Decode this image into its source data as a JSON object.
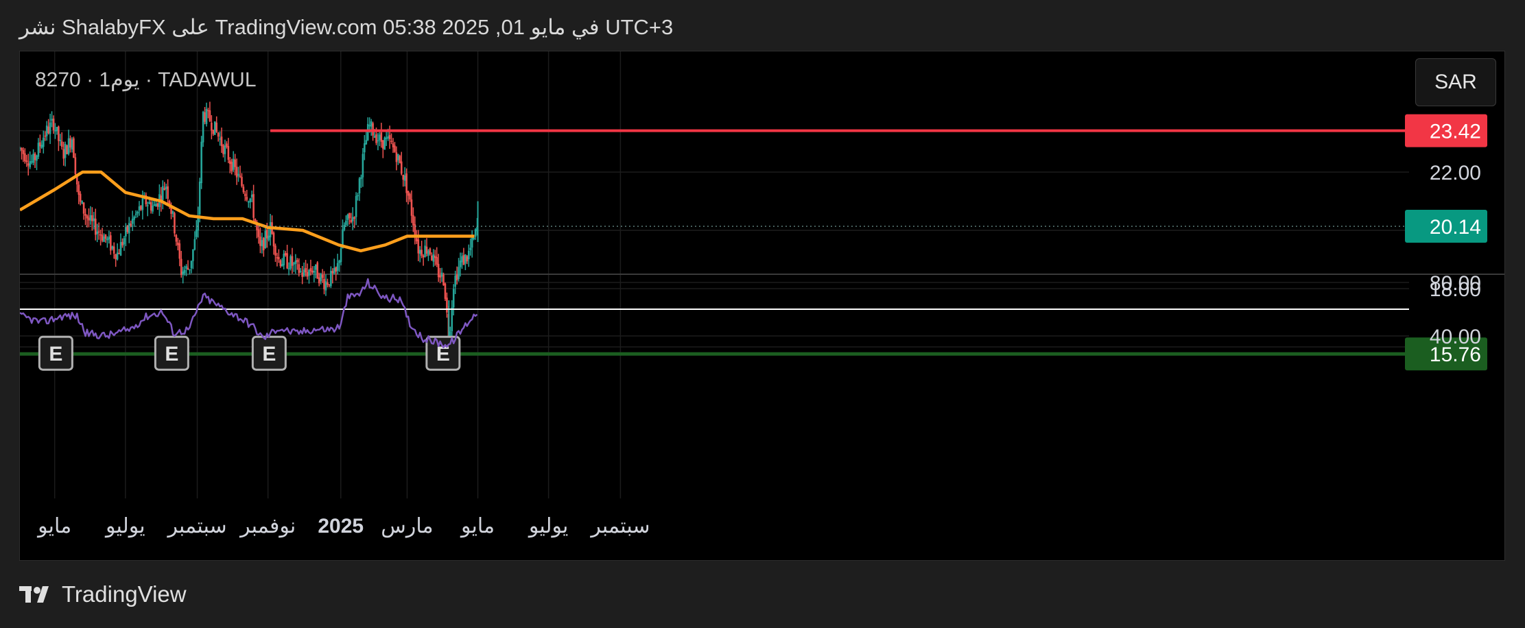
{
  "header": {
    "published_text": "نشر ShalabyFX على TradingView.com 05:38 2025 ,01 في مايو UTC+3"
  },
  "symbol": {
    "label": "8270 · يوم1 · TADAWUL"
  },
  "currency_button": {
    "label": "SAR"
  },
  "footer": {
    "brand": "TradingView"
  },
  "colors": {
    "background": "#000000",
    "page": "#1e1e1e",
    "up": "#26a69a",
    "down": "#ef5350",
    "ma": "#ff9f1c",
    "rsi": "#7e57c2",
    "resistance": "#f23645",
    "support": "#1b5e20",
    "last_price": "#089981",
    "grid": "#1c1c1c"
  },
  "chart_data": {
    "type": "candlestick",
    "price_axis": {
      "ticks": [
        "22.00",
        "18.00"
      ],
      "tick_values": [
        22.0,
        18.0
      ]
    },
    "price_labels": [
      {
        "name": "resistance",
        "value": 23.42,
        "text": "23.42",
        "color": "#f23645"
      },
      {
        "name": "last-price",
        "value": 20.14,
        "text": "20.14",
        "color": "#089981"
      },
      {
        "name": "support",
        "value": 15.76,
        "text": "15.76",
        "color": "#1b5e20"
      }
    ],
    "horizontal_lines": [
      {
        "name": "resistance-line",
        "value": 23.42,
        "color": "#f23645",
        "start_date": "2024-11-03"
      },
      {
        "name": "support-line",
        "value": 15.76,
        "color": "#1b5e20",
        "start_date": "2024-04-01"
      }
    ],
    "earnings_markers": [
      {
        "date": "2024-05-02",
        "label": "E"
      },
      {
        "date": "2024-08-10",
        "label": "E"
      },
      {
        "date": "2024-11-02",
        "label": "E"
      },
      {
        "date": "2025-04-01",
        "label": "E"
      }
    ],
    "time_axis": [
      {
        "date": "2024-05-01",
        "label": "مايو",
        "bold": false
      },
      {
        "date": "2024-07-01",
        "label": "يوليو",
        "bold": false
      },
      {
        "date": "2024-09-01",
        "label": "سبتمبر",
        "bold": false
      },
      {
        "date": "2024-11-01",
        "label": "نوفمبر",
        "bold": false
      },
      {
        "date": "2025-01-01",
        "label": "2025",
        "bold": true
      },
      {
        "date": "2025-03-01",
        "label": "مارس",
        "bold": false
      },
      {
        "date": "2025-05-01",
        "label": "مايو",
        "bold": false
      },
      {
        "date": "2025-07-01",
        "label": "يوليو",
        "bold": false
      },
      {
        "date": "2025-09-01",
        "label": "سبتمبر",
        "bold": false
      }
    ],
    "price_path": [
      [
        "2024-04-01",
        22.8
      ],
      [
        "2024-04-12",
        22.3
      ],
      [
        "2024-04-22",
        23.3
      ],
      [
        "2024-04-30",
        23.7
      ],
      [
        "2024-05-08",
        22.6
      ],
      [
        "2024-05-16",
        23.2
      ],
      [
        "2024-05-22",
        21.0
      ],
      [
        "2024-05-31",
        20.3
      ],
      [
        "2024-06-12",
        19.8
      ],
      [
        "2024-06-24",
        19.2
      ],
      [
        "2024-07-05",
        20.2
      ],
      [
        "2024-07-18",
        21.0
      ],
      [
        "2024-07-26",
        20.8
      ],
      [
        "2024-08-05",
        21.6
      ],
      [
        "2024-08-12",
        20.2
      ],
      [
        "2024-08-18",
        18.6
      ],
      [
        "2024-08-25",
        18.7
      ],
      [
        "2024-09-01",
        20.0
      ],
      [
        "2024-09-06",
        24.0
      ],
      [
        "2024-09-12",
        23.8
      ],
      [
        "2024-09-22",
        23.0
      ],
      [
        "2024-10-02",
        22.2
      ],
      [
        "2024-10-10",
        21.5
      ],
      [
        "2024-10-18",
        21.0
      ],
      [
        "2024-10-25",
        19.3
      ],
      [
        "2024-11-03",
        20.1
      ],
      [
        "2024-11-10",
        19.0
      ],
      [
        "2024-11-20",
        18.9
      ],
      [
        "2024-12-01",
        18.5
      ],
      [
        "2024-12-10",
        18.7
      ],
      [
        "2024-12-20",
        18.2
      ],
      [
        "2024-12-30",
        18.5
      ],
      [
        "2025-01-06",
        20.2
      ],
      [
        "2025-01-14",
        20.5
      ],
      [
        "2025-01-22",
        22.5
      ],
      [
        "2025-01-27",
        23.6
      ],
      [
        "2025-02-05",
        23.1
      ],
      [
        "2025-02-14",
        23.0
      ],
      [
        "2025-02-20",
        22.6
      ],
      [
        "2025-02-28",
        21.6
      ],
      [
        "2025-03-05",
        20.6
      ],
      [
        "2025-03-11",
        19.3
      ],
      [
        "2025-03-20",
        19.4
      ],
      [
        "2025-03-27",
        18.6
      ],
      [
        "2025-04-02",
        18.3
      ],
      [
        "2025-04-06",
        16.2
      ],
      [
        "2025-04-10",
        18.2
      ],
      [
        "2025-04-16",
        18.9
      ],
      [
        "2025-04-22",
        19.1
      ],
      [
        "2025-04-27",
        19.6
      ],
      [
        "2025-05-01",
        20.14
      ]
    ],
    "ma_series": [
      [
        "2024-04-01",
        20.7
      ],
      [
        "2024-05-01",
        21.4
      ],
      [
        "2024-05-25",
        22.0
      ],
      [
        "2024-06-10",
        22.0
      ],
      [
        "2024-07-01",
        21.3
      ],
      [
        "2024-08-01",
        21.0
      ],
      [
        "2024-08-25",
        20.5
      ],
      [
        "2024-09-15",
        20.4
      ],
      [
        "2024-10-10",
        20.4
      ],
      [
        "2024-11-01",
        20.1
      ],
      [
        "2024-12-01",
        20.0
      ],
      [
        "2025-01-01",
        19.5
      ],
      [
        "2025-01-20",
        19.3
      ],
      [
        "2025-02-10",
        19.5
      ],
      [
        "2025-03-01",
        19.8
      ],
      [
        "2025-04-01",
        19.8
      ],
      [
        "2025-04-28",
        19.8
      ]
    ],
    "rsi": {
      "ticks": [
        "80.00",
        "40.00"
      ],
      "tick_values": [
        80,
        40
      ],
      "reference_level": 60,
      "series": [
        [
          "2024-04-01",
          55
        ],
        [
          "2024-04-20",
          50
        ],
        [
          "2024-05-08",
          55
        ],
        [
          "2024-05-20",
          55
        ],
        [
          "2024-05-28",
          42
        ],
        [
          "2024-06-15",
          40
        ],
        [
          "2024-07-05",
          45
        ],
        [
          "2024-07-20",
          55
        ],
        [
          "2024-08-02",
          58
        ],
        [
          "2024-08-12",
          42
        ],
        [
          "2024-08-25",
          45
        ],
        [
          "2024-09-06",
          70
        ],
        [
          "2024-09-20",
          62
        ],
        [
          "2024-10-05",
          55
        ],
        [
          "2024-10-18",
          48
        ],
        [
          "2024-10-28",
          38
        ],
        [
          "2024-11-10",
          46
        ],
        [
          "2024-11-25",
          42
        ],
        [
          "2024-12-10",
          45
        ],
        [
          "2024-12-28",
          45
        ],
        [
          "2025-01-03",
          48
        ],
        [
          "2025-01-08",
          68
        ],
        [
          "2025-01-20",
          72
        ],
        [
          "2025-01-26",
          80
        ],
        [
          "2025-02-10",
          68
        ],
        [
          "2025-02-22",
          68
        ],
        [
          "2025-03-05",
          47
        ],
        [
          "2025-03-15",
          38
        ],
        [
          "2025-03-28",
          35
        ],
        [
          "2025-04-06",
          33
        ],
        [
          "2025-04-15",
          42
        ],
        [
          "2025-04-24",
          52
        ],
        [
          "2025-05-01",
          58
        ]
      ]
    }
  }
}
